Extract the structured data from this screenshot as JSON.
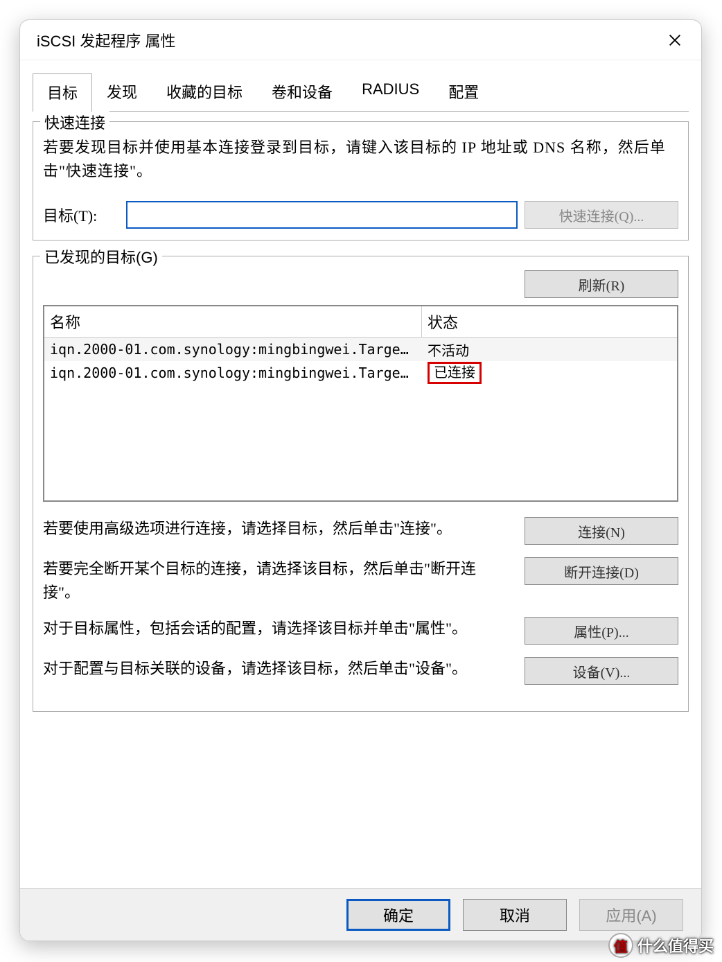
{
  "window": {
    "title": "iSCSI 发起程序 属性"
  },
  "tabs": {
    "targets": "目标",
    "discovery": "发现",
    "favorites": "收藏的目标",
    "volumes": "卷和设备",
    "radius": "RADIUS",
    "config": "配置"
  },
  "quick_connect": {
    "legend": "快速连接",
    "desc": "若要发现目标并使用基本连接登录到目标，请键入该目标的 IP 地址或 DNS 名称，然后单击\"快速连接\"。",
    "target_label": "目标(T):",
    "target_value": "",
    "button": "快速连接(Q)..."
  },
  "discovered": {
    "legend": "已发现的目标(G)",
    "refresh": "刷新(R)",
    "col_name": "名称",
    "col_status": "状态",
    "rows": [
      {
        "name": "iqn.2000-01.com.synology:mingbingwei.Target-...",
        "status": "不活动"
      },
      {
        "name": "iqn.2000-01.com.synology:mingbingwei.Target-...",
        "status": "已连接"
      }
    ]
  },
  "actions": {
    "connect_text": "若要使用高级选项进行连接，请选择目标，然后单击\"连接\"。",
    "connect_btn": "连接(N)",
    "disconnect_text": "若要完全断开某个目标的连接，请选择该目标，然后单击\"断开连接\"。",
    "disconnect_btn": "断开连接(D)",
    "properties_text": "对于目标属性，包括会话的配置，请选择该目标并单击\"属性\"。",
    "properties_btn": "属性(P)...",
    "devices_text": "对于配置与目标关联的设备，请选择该目标，然后单击\"设备\"。",
    "devices_btn": "设备(V)..."
  },
  "bottom": {
    "ok": "确定",
    "cancel": "取消",
    "apply": "应用(A)"
  },
  "watermark": "什么值得买"
}
